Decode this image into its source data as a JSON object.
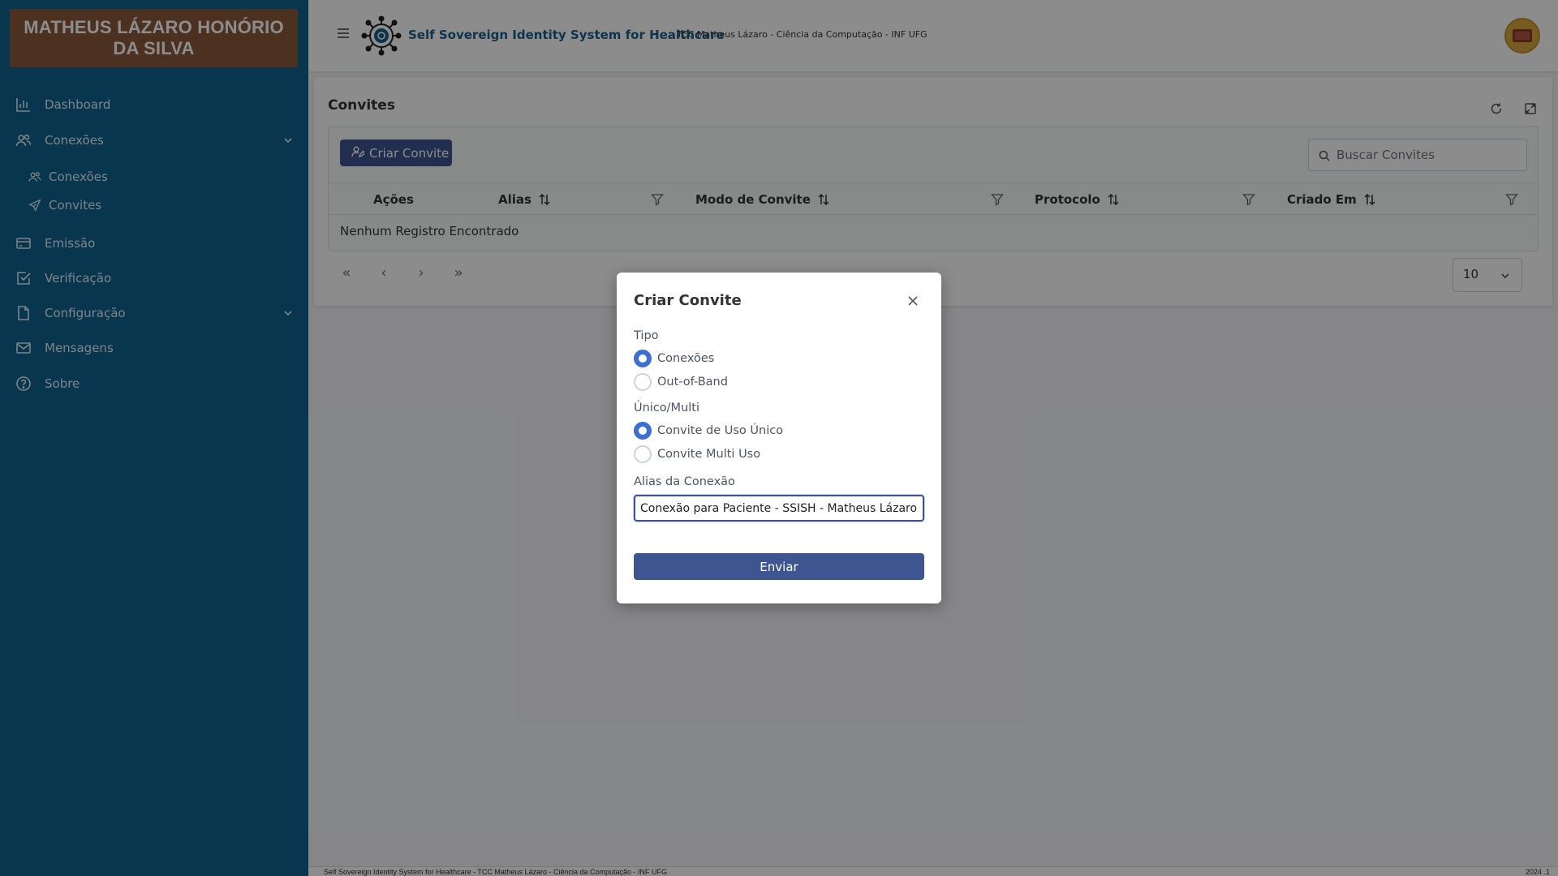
{
  "sidebar": {
    "brand": "MATHEUS LÁZARO HONÓRIO DA SILVA",
    "items": [
      {
        "label": "Dashboard",
        "icon": "chart-bar-icon"
      },
      {
        "label": "Conexões",
        "icon": "users-icon",
        "expanded": true
      },
      {
        "label": "Emissão",
        "icon": "credit-card-icon"
      },
      {
        "label": "Verificação",
        "icon": "check-square-icon"
      },
      {
        "label": "Configuração",
        "icon": "file-icon",
        "expanded": false
      },
      {
        "label": "Mensagens",
        "icon": "envelope-icon"
      },
      {
        "label": "Sobre",
        "icon": "question-circle-icon"
      }
    ],
    "subitems": [
      {
        "label": "Conexões",
        "icon": "users-icon"
      },
      {
        "label": "Convites",
        "icon": "send-icon"
      }
    ]
  },
  "topbar": {
    "title": "Self Sovereign Identity System for Healthcare",
    "subtitle": "TCC Matheus Lázaro - Ciência da Computação - INF UFG"
  },
  "page": {
    "title": "Convites",
    "create_button": "Criar Convite",
    "search_placeholder": "Buscar Convites",
    "columns": [
      "Ações",
      "Alias",
      "Modo de Convite",
      "Protocolo",
      "Criado Em"
    ],
    "empty_message": "Nenhum Registro Encontrado",
    "rows_per_page": "10"
  },
  "footer": {
    "left": "Self Sovereign Identity System for Healthcare - TCC Matheus Lázaro - Ciência da Computação - INF UFG",
    "right": "2024 .1"
  },
  "dialog": {
    "title": "Criar Convite",
    "type_label": "Tipo",
    "type_options": [
      "Conexões",
      "Out-of-Band"
    ],
    "type_selected": "Conexões",
    "use_label": "Único/Multi",
    "use_options": [
      "Convite de Uso Único",
      "Convite Multi Uso"
    ],
    "use_selected": "Convite de Uso Único",
    "alias_label": "Alias da Conexão",
    "alias_value": "Conexão para Paciente - SSISH - Matheus Lázaro",
    "submit": "Enviar"
  },
  "colors": {
    "sidebar": "#0f6390",
    "brand_bg": "#8a5a3c",
    "primary_button": "#3e5591",
    "radio_checked": "#3b6fd1"
  }
}
